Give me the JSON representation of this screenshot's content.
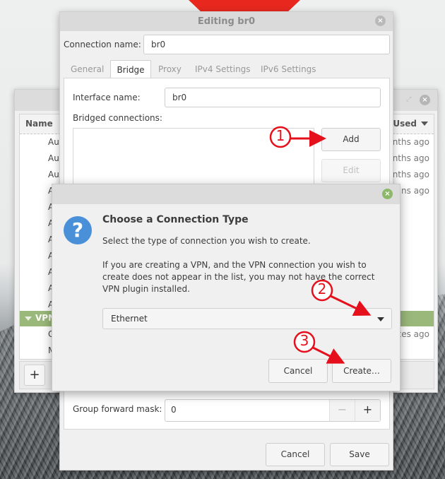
{
  "background_window": {
    "columns": {
      "name": "Name",
      "last_used": "Used"
    },
    "rows": [
      {
        "name": "Au",
        "used": "nths ago"
      },
      {
        "name": "Au",
        "used": "nths ago"
      },
      {
        "name": "Au",
        "used": "nths ago"
      },
      {
        "name": "A",
        "used": "ns ago"
      },
      {
        "name": "A",
        "used": ""
      },
      {
        "name": "A",
        "used": ""
      },
      {
        "name": "A",
        "used": ""
      },
      {
        "name": "A",
        "used": ""
      },
      {
        "name": "A",
        "used": ""
      },
      {
        "name": "A",
        "used": ""
      },
      {
        "name": "A",
        "used": ""
      }
    ],
    "group": {
      "label": "VPN",
      "color": "#9ab87a"
    },
    "group_rows": [
      {
        "name": "C",
        "used": "tes ago"
      },
      {
        "name": "M",
        "used": ""
      }
    ],
    "add_label": "+"
  },
  "edit_dialog": {
    "title": "Editing br0",
    "connection_name_label": "Connection name:",
    "connection_name_value": "br0",
    "tabs": [
      {
        "label": "General",
        "active": false
      },
      {
        "label": "Bridge",
        "active": true
      },
      {
        "label": "Proxy",
        "active": false
      },
      {
        "label": "IPv4 Settings",
        "active": false
      },
      {
        "label": "IPv6 Settings",
        "active": false
      }
    ],
    "interface_name_label": "Interface name:",
    "interface_name_value": "br0",
    "bridged_connections_label": "Bridged connections:",
    "add_button": "Add",
    "edit_button": "Edit",
    "group_forward_mask_label": "Group forward mask:",
    "group_forward_mask_value": "0",
    "minus": "−",
    "plus": "+",
    "cancel_button": "Cancel",
    "save_button": "Save"
  },
  "choose_dialog": {
    "heading": "Choose a Connection Type",
    "line1": "Select the type of connection you wish to create.",
    "line2": "If you are creating a VPN, and the VPN connection you wish to create does not appear in the list, you may not have the correct VPN plugin installed.",
    "selected_type": "Ethernet",
    "cancel_button": "Cancel",
    "create_button": "Create…",
    "icon_color": "#4a90d9",
    "close_color": "#8cb86a"
  },
  "annotations": [
    {
      "number": "1"
    },
    {
      "number": "2"
    },
    {
      "number": "3"
    }
  ],
  "annotation_color": "#e5101b"
}
